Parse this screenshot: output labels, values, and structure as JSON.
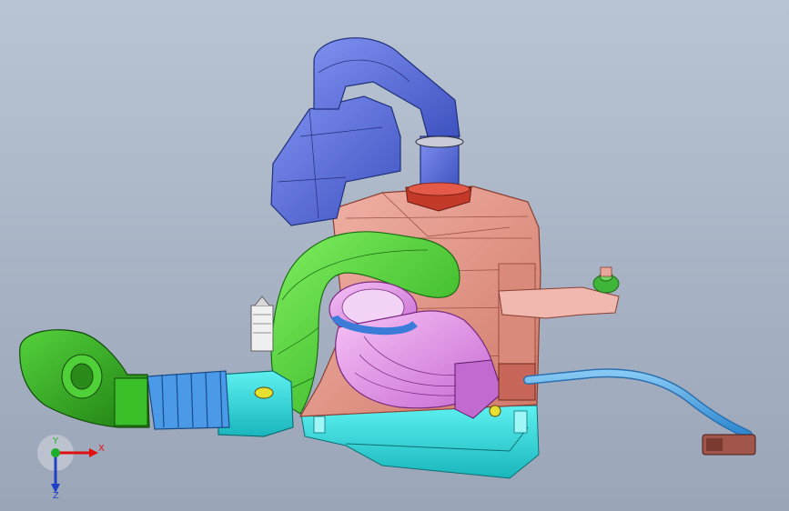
{
  "scene": {
    "model": "engine-intake-assembly"
  },
  "triad": {
    "x_label": "X",
    "y_label": "Y",
    "z_label": "Z",
    "x_color": "#e01010",
    "y_color": "#1fae2a",
    "z_color": "#2040c8"
  },
  "colors": {
    "housing": "#e59c8c",
    "airbox": "#5f72d8",
    "hose_green": "#3fcf2a",
    "throttle_pink": "#e58fe8",
    "base_cyan": "#24d4d8",
    "filter_green": "#2ea81d",
    "pipe_blue": "#4aa8e8",
    "clamp_blue": "#3a7cd8",
    "flange_red": "#c43a2a"
  }
}
